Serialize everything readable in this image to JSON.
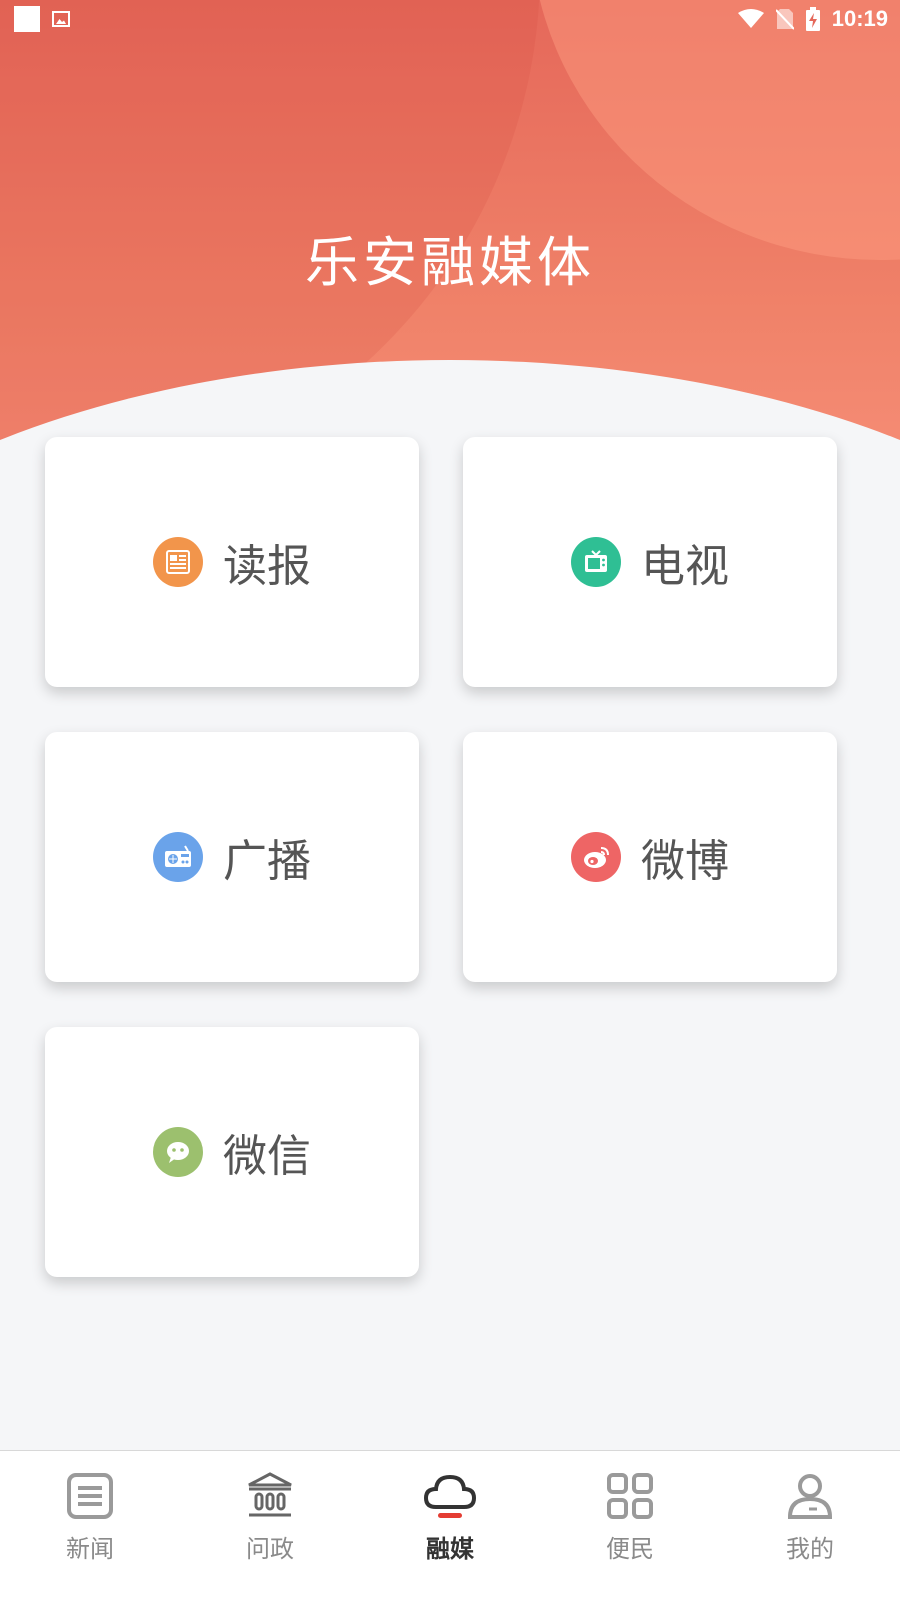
{
  "status_bar": {
    "time": "10:19"
  },
  "header": {
    "title": "乐安融媒体"
  },
  "cards": [
    {
      "label": "读报",
      "icon": "newspaper-icon",
      "color": "#f2954b"
    },
    {
      "label": "电视",
      "icon": "tv-icon",
      "color": "#2fbf94"
    },
    {
      "label": "广播",
      "icon": "radio-icon",
      "color": "#6aa3ea"
    },
    {
      "label": "微博",
      "icon": "weibo-icon",
      "color": "#ee6565"
    },
    {
      "label": "微信",
      "icon": "wechat-icon",
      "color": "#9cc06e"
    }
  ],
  "tabs": [
    {
      "label": "新闻",
      "icon": "news-icon"
    },
    {
      "label": "问政",
      "icon": "government-icon"
    },
    {
      "label": "融媒",
      "icon": "cloud-icon",
      "active": true
    },
    {
      "label": "便民",
      "icon": "grid-icon"
    },
    {
      "label": "我的",
      "icon": "user-icon"
    }
  ],
  "colors": {
    "accent": "#e5685a",
    "active_indicator": "#e43d33"
  }
}
